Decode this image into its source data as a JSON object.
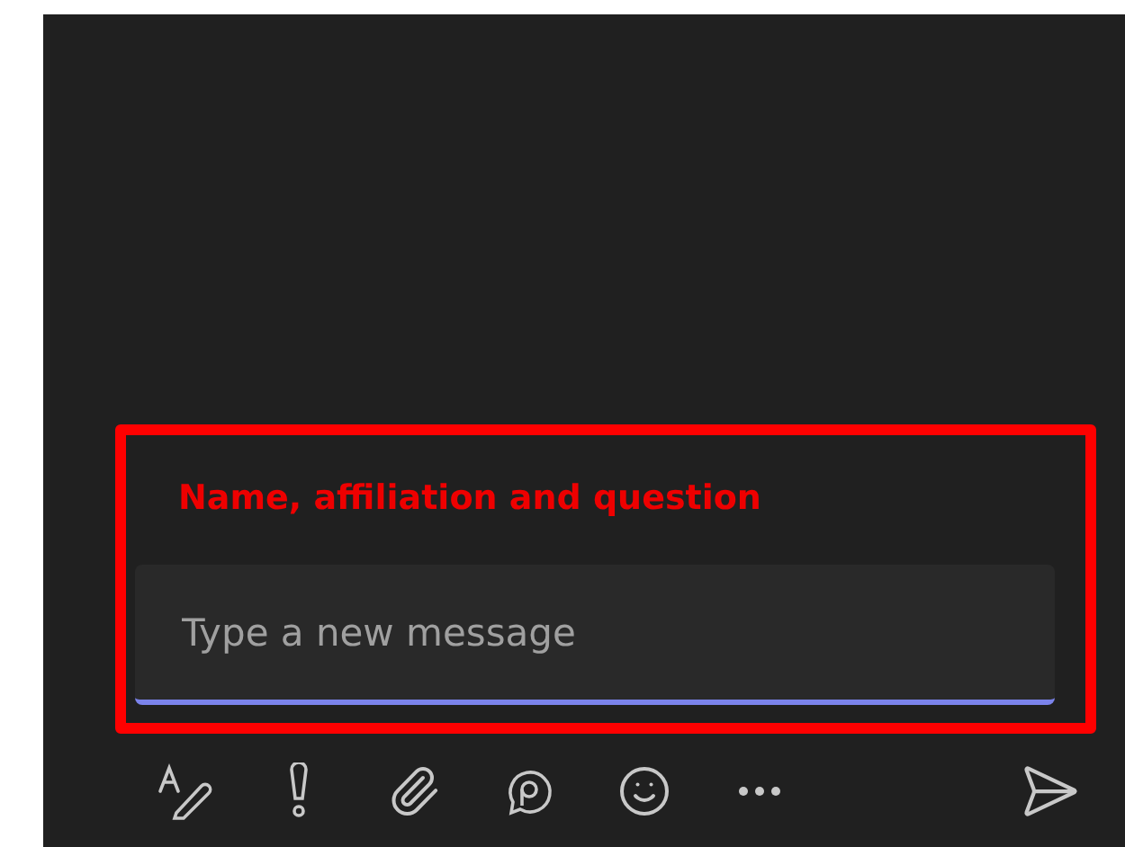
{
  "annotation": {
    "label": "Name, affiliation and question"
  },
  "compose": {
    "placeholder": "Type a new message"
  },
  "toolbar": [
    {
      "kind": "format"
    },
    {
      "kind": "priority"
    },
    {
      "kind": "attach"
    },
    {
      "kind": "loop"
    },
    {
      "kind": "emoji"
    },
    {
      "kind": "more"
    }
  ],
  "send": {
    "kind": "send"
  }
}
